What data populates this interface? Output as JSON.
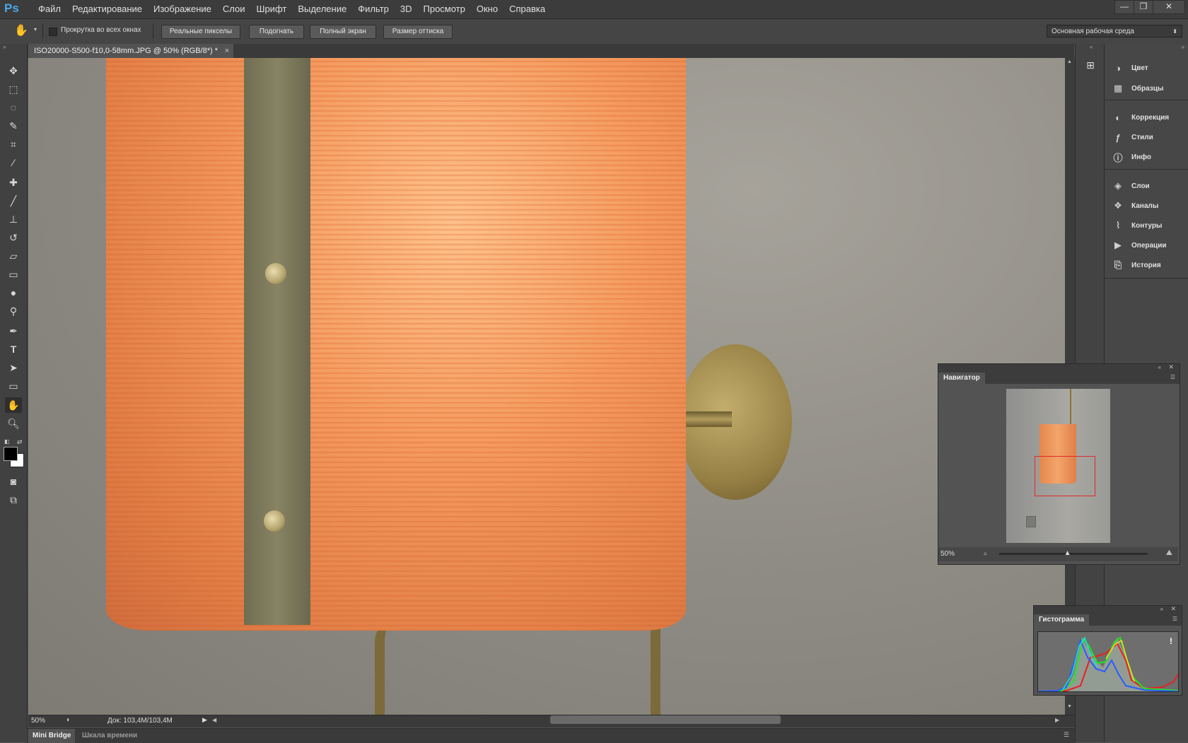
{
  "app": {
    "logo": "Ps"
  },
  "menu": [
    "Файл",
    "Редактирование",
    "Изображение",
    "Слои",
    "Шрифт",
    "Выделение",
    "Фильтр",
    "3D",
    "Просмотр",
    "Окно",
    "Справка"
  ],
  "window_buttons": {
    "minimize": "—",
    "restore": "❐",
    "close": "✕"
  },
  "options_bar": {
    "scroll_all_label": "Прокрутка во всех окнах",
    "buttons": [
      "Реальные пикселы",
      "Подогнать",
      "Полный экран",
      "Размер оттиска"
    ],
    "workspace": "Основная рабочая среда"
  },
  "document": {
    "tab_title": "ISO20000-S500-f10,0-58mm.JPG @ 50% (RGB/8*)",
    "modified_mark": "*",
    "close": "×"
  },
  "status": {
    "zoom": "50%",
    "doc_size": "Док: 103,4M/103,4M"
  },
  "bottom_tabs": [
    "Mini Bridge",
    "Шкала времени"
  ],
  "right_panels": [
    {
      "label": "Цвет",
      "icon": "palette-icon"
    },
    {
      "label": "Образцы",
      "icon": "swatches-icon"
    },
    {
      "label": "Коррекция",
      "icon": "adjustments-icon"
    },
    {
      "label": "Стили",
      "icon": "styles-icon"
    },
    {
      "label": "Инфо",
      "icon": "info-icon"
    },
    {
      "label": "Слои",
      "icon": "layers-icon"
    },
    {
      "label": "Каналы",
      "icon": "channels-icon"
    },
    {
      "label": "Контуры",
      "icon": "paths-icon"
    },
    {
      "label": "Операции",
      "icon": "actions-icon"
    },
    {
      "label": "История",
      "icon": "history-icon"
    }
  ],
  "navigator": {
    "title": "Навигатор",
    "zoom": "50%",
    "slider_value_pct": 46
  },
  "histogram": {
    "title": "Гистограмма",
    "warning": "!"
  },
  "colors": {
    "accent": "#4aa8e8",
    "view_box": "#e02a2a"
  }
}
